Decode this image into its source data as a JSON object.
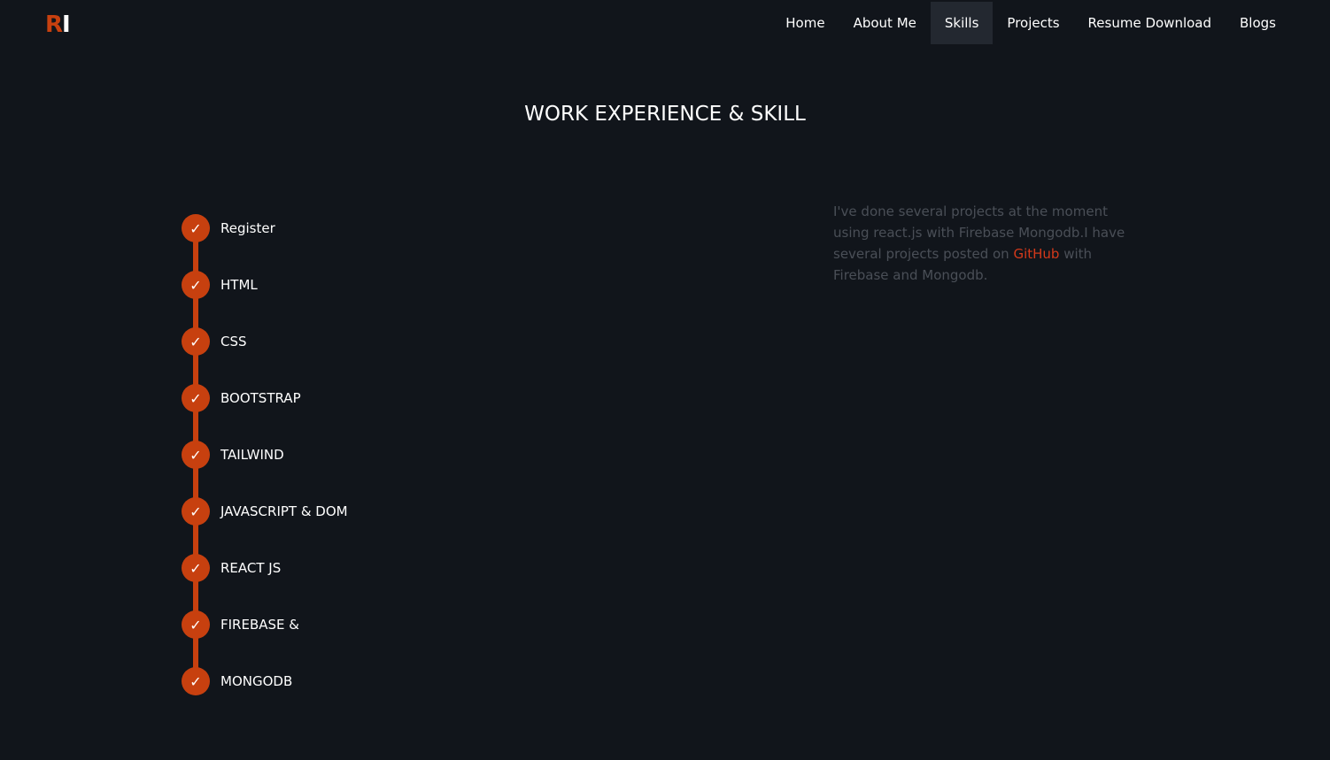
{
  "logo": {
    "first": "R",
    "second": "I"
  },
  "nav": {
    "items": [
      {
        "label": "Home",
        "active": false
      },
      {
        "label": "About Me",
        "active": false
      },
      {
        "label": "Skills",
        "active": true
      },
      {
        "label": "Projects",
        "active": false
      },
      {
        "label": "Resume Download",
        "active": false
      },
      {
        "label": "Blogs",
        "active": false
      }
    ]
  },
  "section": {
    "title": "WORK EXPERIENCE & SKILL"
  },
  "skills": [
    {
      "label": "Register",
      "icon": "check-icon"
    },
    {
      "label": "HTML",
      "icon": "check-icon"
    },
    {
      "label": "CSS",
      "icon": "check-icon"
    },
    {
      "label": "BOOTSTRAP",
      "icon": "check-icon"
    },
    {
      "label": "TAILWIND",
      "icon": "check-icon"
    },
    {
      "label": "JAVASCRIPT & DOM",
      "icon": "check-icon"
    },
    {
      "label": "REACT JS",
      "icon": "check-icon"
    },
    {
      "label": "FIREBASE &",
      "icon": "check-icon"
    },
    {
      "label": "MONGODB",
      "icon": "check-icon"
    }
  ],
  "description": {
    "before": "I've done several projects at the moment using react.js with Firebase Mongodb.I have several projects posted on ",
    "link": "GitHub",
    "after": " with Firebase and Mongodb."
  },
  "colors": {
    "background": "#11151b",
    "accent": "#c7400f",
    "link": "#d4391a",
    "muted_text": "#4a4f57",
    "nav_active_bg": "#232830"
  }
}
